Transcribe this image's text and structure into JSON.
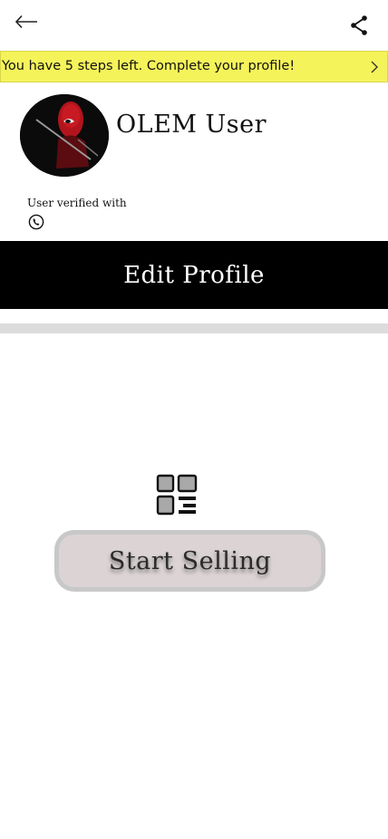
{
  "header": {
    "back_icon": "arrow-left-icon",
    "share_icon": "share-icon"
  },
  "banner": {
    "text": "You have 5 steps left. Complete your profile!",
    "chevron_icon": "chevron-right-icon",
    "background": "#f5f35a"
  },
  "profile": {
    "avatar_icon": "avatar-image",
    "name": "OLEM User",
    "verified_label": "User verified with",
    "verified_icon": "whatsapp-phone-icon"
  },
  "actions": {
    "edit_profile_label": "Edit Profile",
    "listings_icon": "grid-list-icon",
    "start_selling_label": "Start Selling"
  },
  "colors": {
    "edit_profile_bg": "#000000",
    "start_selling_bg": "#dcd4d4"
  }
}
